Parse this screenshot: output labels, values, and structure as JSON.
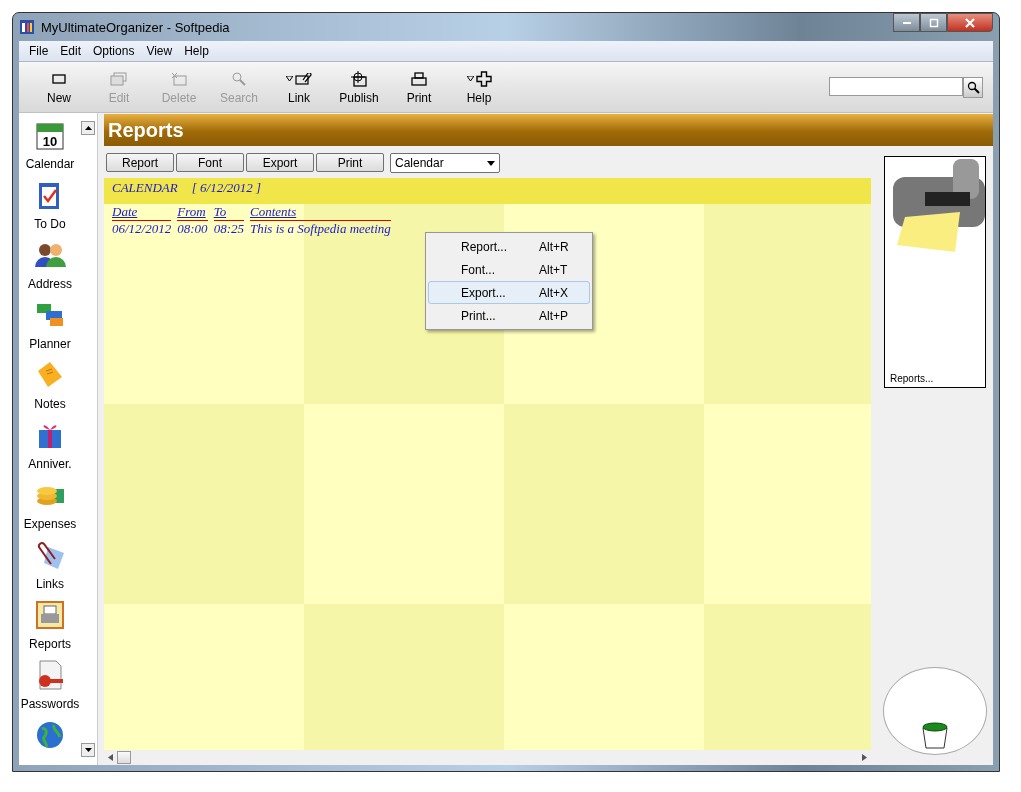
{
  "window": {
    "title": "MyUltimateOrganizer - Softpedia"
  },
  "menu_bar": [
    "File",
    "Edit",
    "Options",
    "View",
    "Help"
  ],
  "toolbar": [
    {
      "label": "New",
      "kind": "new",
      "disabled": false,
      "dropdown": false
    },
    {
      "label": "Edit",
      "kind": "edit",
      "disabled": true,
      "dropdown": false
    },
    {
      "label": "Delete",
      "kind": "delete",
      "disabled": true,
      "dropdown": false
    },
    {
      "label": "Search",
      "kind": "search",
      "disabled": true,
      "dropdown": false
    },
    {
      "label": "Link",
      "kind": "link",
      "disabled": false,
      "dropdown": true
    },
    {
      "label": "Publish",
      "kind": "publish",
      "disabled": false,
      "dropdown": false
    },
    {
      "label": "Print",
      "kind": "print",
      "disabled": false,
      "dropdown": false
    },
    {
      "label": "Help",
      "kind": "help",
      "disabled": false,
      "dropdown": true
    }
  ],
  "sidebar": {
    "items": [
      {
        "label": "Calendar",
        "kind": "calendar",
        "day": "10"
      },
      {
        "label": "To Do",
        "kind": "todo"
      },
      {
        "label": "Address",
        "kind": "address"
      },
      {
        "label": "Planner",
        "kind": "planner"
      },
      {
        "label": "Notes",
        "kind": "notes"
      },
      {
        "label": "Anniver.",
        "kind": "gift"
      },
      {
        "label": "Expenses",
        "kind": "coins"
      },
      {
        "label": "Links",
        "kind": "links"
      },
      {
        "label": "Reports",
        "kind": "reports"
      },
      {
        "label": "Passwords",
        "kind": "passwords"
      },
      {
        "kind": "globe"
      }
    ]
  },
  "header": {
    "title": "Reports"
  },
  "report_buttons": [
    "Report",
    "Font",
    "Export",
    "Print"
  ],
  "report_select": {
    "value": "Calendar"
  },
  "report": {
    "title": "CALENDAR",
    "date": "[ 6/12/2012 ]",
    "columns": [
      "Date",
      "From",
      "To",
      "Contents"
    ],
    "rows": [
      [
        "06/12/2012",
        "08:00",
        "08:25",
        "This is a Softpedia meeting"
      ]
    ]
  },
  "context_menu": [
    {
      "label": "Report...",
      "shortcut": "Alt+R",
      "selected": false
    },
    {
      "label": "Font...",
      "shortcut": "Alt+T",
      "selected": false
    },
    {
      "label": "Export...",
      "shortcut": "Alt+X",
      "selected": true
    },
    {
      "label": "Print...",
      "shortcut": "Alt+P",
      "selected": false
    }
  ],
  "preview": {
    "caption": "Reports..."
  }
}
